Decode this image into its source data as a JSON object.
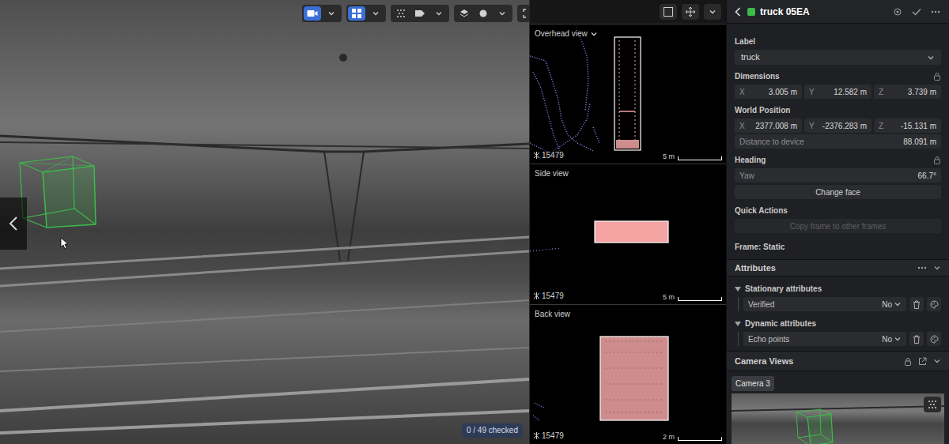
{
  "camera": {
    "badge": "0 / 49 checked"
  },
  "views": [
    {
      "title": "Overhead view",
      "kind": "select",
      "frame": "15479",
      "scale": "5 m"
    },
    {
      "title": "Side view",
      "kind": "plain",
      "frame": "15479",
      "scale": "5 m"
    },
    {
      "title": "Back view",
      "kind": "plain",
      "frame": "15479",
      "scale": "2 m"
    }
  ],
  "panel": {
    "title": "truck 05EA",
    "color": "#3dbb4a",
    "label": {
      "heading": "Label",
      "value": "truck"
    },
    "dimensions": {
      "heading": "Dimensions",
      "locked": true,
      "fields": [
        {
          "axis": "X",
          "value": "3.005 m"
        },
        {
          "axis": "Y",
          "value": "12.582 m"
        },
        {
          "axis": "Z",
          "value": "3.739 m"
        }
      ]
    },
    "world_position": {
      "heading": "World Position",
      "fields": [
        {
          "axis": "X",
          "value": "2377.008 m"
        },
        {
          "axis": "Y",
          "value": "-2376.283 m"
        },
        {
          "axis": "Z",
          "value": "-15.131 m"
        }
      ],
      "distance_label": "Distance to device",
      "distance": "88.091 m"
    },
    "heading": {
      "heading": "Heading",
      "locked": true,
      "yaw_label": "Yaw",
      "yaw": "66.7°",
      "button": "Change face"
    },
    "quick_actions": {
      "heading": "Quick Actions",
      "button": "Copy frame to other frames",
      "disabled": true
    },
    "frame": "Frame: Static",
    "attributes": {
      "heading": "Attributes",
      "groups": [
        {
          "title": "Stationary attributes",
          "expanded": true,
          "items": [
            {
              "name": "Verified",
              "value": "No"
            }
          ]
        },
        {
          "title": "Dynamic attributes",
          "expanded": true,
          "items": [
            {
              "name": "Echo points",
              "value": "No"
            }
          ]
        }
      ]
    },
    "camera_views": {
      "heading": "Camera Views",
      "tabs": [
        {
          "label": "Camera 3",
          "selected": true
        }
      ]
    }
  }
}
